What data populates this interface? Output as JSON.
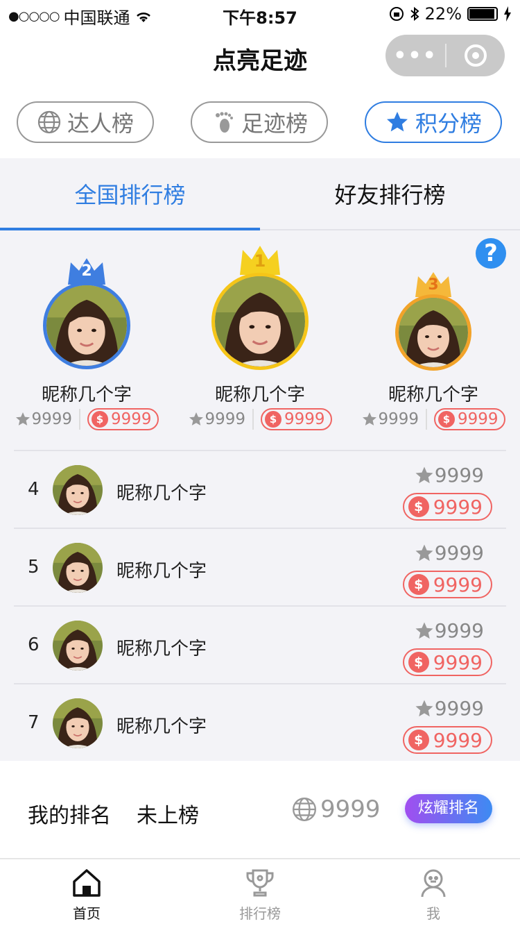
{
  "status_bar": {
    "signal": "●○○○○",
    "carrier": "中国联通",
    "time": "下午8:57",
    "battery": "22%"
  },
  "nav": {
    "title": "点亮足迹"
  },
  "top_tabs": [
    {
      "label": "达人榜",
      "icon": "globe-icon",
      "active": false
    },
    {
      "label": "足迹榜",
      "icon": "footprint-icon",
      "active": false
    },
    {
      "label": "积分榜",
      "icon": "star-icon",
      "active": true
    }
  ],
  "sub_tabs": [
    {
      "label": "全国排行榜",
      "active": true
    },
    {
      "label": "好友排行榜",
      "active": false
    }
  ],
  "help_icon": "?",
  "podium": [
    {
      "rank": "2",
      "name": "昵称几个字",
      "stars": "9999",
      "coins": "9999",
      "ring": "#3f7ee0",
      "crown": "#3f7ee0"
    },
    {
      "rank": "1",
      "name": "昵称几个字",
      "stars": "9999",
      "coins": "9999",
      "ring": "#f5c518",
      "crown": "#f5d020"
    },
    {
      "rank": "3",
      "name": "昵称几个字",
      "stars": "9999",
      "coins": "9999",
      "ring": "#f2a329",
      "crown": "#f5b83a"
    }
  ],
  "coin_symbol": "$",
  "list": [
    {
      "rank": "4",
      "name": "昵称几个字",
      "stars": "9999",
      "coins": "9999"
    },
    {
      "rank": "5",
      "name": "昵称几个字",
      "stars": "9999",
      "coins": "9999"
    },
    {
      "rank": "6",
      "name": "昵称几个字",
      "stars": "9999",
      "coins": "9999"
    },
    {
      "rank": "7",
      "name": "昵称几个字",
      "stars": "9999",
      "coins": "9999"
    }
  ],
  "my_rank": {
    "label": "我的排名",
    "status": "未上榜",
    "score": "9999",
    "button": "炫耀排名"
  },
  "tab_bar": [
    {
      "label": "首页",
      "icon": "home-icon",
      "active": true
    },
    {
      "label": "排行榜",
      "icon": "trophy-icon",
      "active": false
    },
    {
      "label": "我",
      "icon": "user-icon",
      "active": false
    }
  ],
  "colors": {
    "accent": "#2f7de1",
    "coin": "#f06462"
  }
}
